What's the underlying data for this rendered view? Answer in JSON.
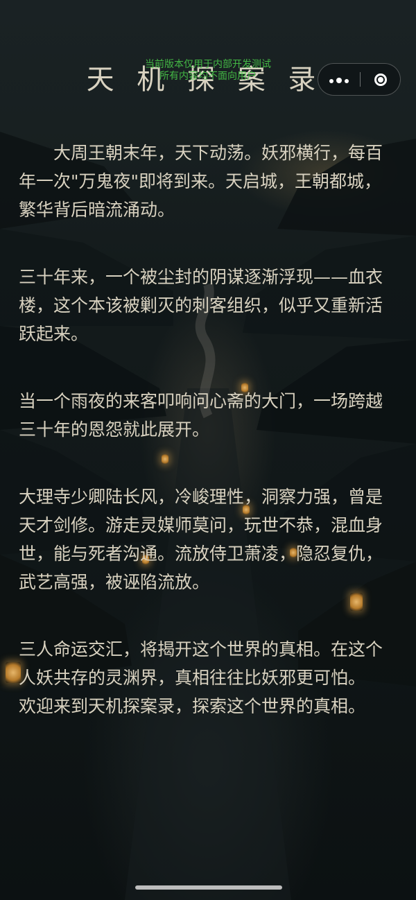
{
  "header": {
    "title": "天 机 探 案 录",
    "watermark_line1": "当前版本仅用于内部开发测试",
    "watermark_line2": "所有内容均不面向用户"
  },
  "capsule": {
    "more_icon": "more-dots-icon",
    "close_icon": "target-close-icon"
  },
  "story": {
    "paragraphs": [
      "大周王朝末年，天下动荡。妖邪横行，每百年一次\"万鬼夜\"即将到来。天启城，王朝都城，繁华背后暗流涌动。",
      "三十年来，一个被尘封的阴谋逐渐浮现——血衣楼，这个本该被剿灭的刺客组织，似乎又重新活跃起来。",
      "当一个雨夜的来客叩响问心斋的大门，一场跨越三十年的恩怨就此展开。",
      "大理寺少卿陆长风，冷峻理性，洞察力强，曾是天才剑修。游走灵媒师莫问，玩世不恭，混血身世，能与死者沟通。流放侍卫萧凌，隐忍复仇，武艺高强，被诬陷流放。",
      "三人命运交汇，将揭开这个世界的真相。在这个人妖共存的灵渊界，真相往往比妖邪更可怕。",
      "欢迎来到天机探案录，探索这个世界的真相。"
    ]
  },
  "colors": {
    "text": "#d9d2c0",
    "watermark": "#4bd24b",
    "background": "#111819"
  }
}
